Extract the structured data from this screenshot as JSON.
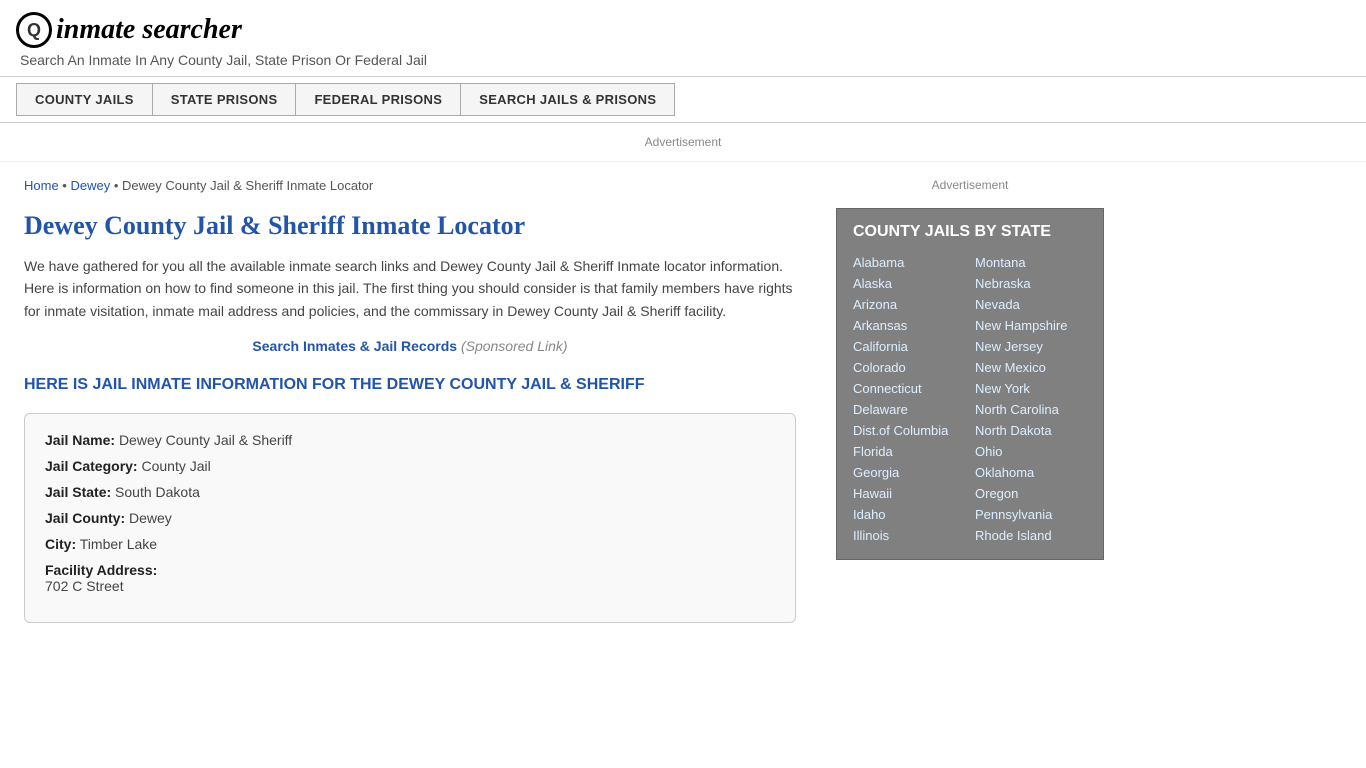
{
  "header": {
    "logo_icon": "🔍",
    "logo_text_prefix": "inmate",
    "logo_text_suffix": "searcher",
    "tagline": "Search An Inmate In Any County Jail, State Prison Or Federal Jail"
  },
  "nav": {
    "buttons": [
      {
        "id": "county-jails",
        "label": "COUNTY JAILS"
      },
      {
        "id": "state-prisons",
        "label": "STATE PRISONS"
      },
      {
        "id": "federal-prisons",
        "label": "FEDERAL PRISONS"
      },
      {
        "id": "search-jails",
        "label": "SEARCH JAILS & PRISONS"
      }
    ]
  },
  "ad": {
    "label": "Advertisement"
  },
  "breadcrumb": {
    "home": "Home",
    "parent": "Dewey",
    "current": "Dewey County Jail & Sheriff Inmate Locator"
  },
  "page": {
    "title": "Dewey County Jail & Sheriff Inmate Locator",
    "description": "We have gathered for you all the available inmate search links and Dewey County Jail & Sheriff Inmate locator information. Here is information on how to find someone in this jail. The first thing you should consider is that family members have rights for inmate visitation, inmate mail address and policies, and the commissary in Dewey County Jail & Sheriff facility.",
    "sponsored_link_text": "Search Inmates & Jail Records",
    "sponsored_suffix": "(Sponsored Link)",
    "section_heading": "HERE IS JAIL INMATE INFORMATION FOR THE DEWEY COUNTY JAIL & SHERIFF",
    "info": {
      "jail_name_label": "Jail Name:",
      "jail_name_value": "Dewey County Jail & Sheriff",
      "jail_category_label": "Jail Category:",
      "jail_category_value": "County Jail",
      "jail_state_label": "Jail State:",
      "jail_state_value": "South Dakota",
      "jail_county_label": "Jail County:",
      "jail_county_value": "Dewey",
      "city_label": "City:",
      "city_value": "Timber Lake",
      "facility_address_label": "Facility Address:",
      "facility_address_value": "702 C Street"
    }
  },
  "sidebar": {
    "ad_label": "Advertisement",
    "county_jails_title": "COUNTY JAILS BY STATE",
    "states_col1": [
      "Alabama",
      "Alaska",
      "Arizona",
      "Arkansas",
      "California",
      "Colorado",
      "Connecticut",
      "Delaware",
      "Dist.of Columbia",
      "Florida",
      "Georgia",
      "Hawaii",
      "Idaho",
      "Illinois"
    ],
    "states_col2": [
      "Montana",
      "Nebraska",
      "Nevada",
      "New Hampshire",
      "New Jersey",
      "New Mexico",
      "New York",
      "North Carolina",
      "North Dakota",
      "Ohio",
      "Oklahoma",
      "Oregon",
      "Pennsylvania",
      "Rhode Island"
    ]
  }
}
